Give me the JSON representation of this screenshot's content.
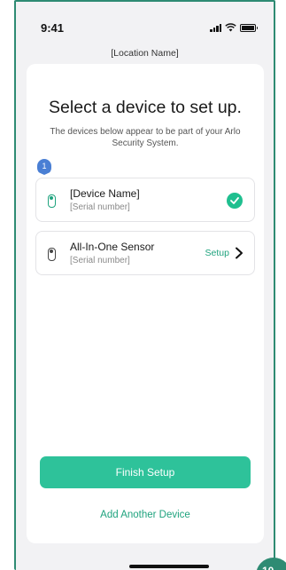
{
  "status_bar": {
    "time": "9:41"
  },
  "header": {
    "location_name": "[Location Name]"
  },
  "main": {
    "title": "Select a device to set up.",
    "subtitle": "The devices below appear to be part of your Arlo Security System.",
    "devices": [
      {
        "name": "[Device Name]",
        "serial": "[Serial number]",
        "state": "complete",
        "icon": "camera-icon"
      },
      {
        "name": "All-In-One Sensor",
        "serial": "[Serial number]",
        "action": "Setup",
        "icon": "sensor-icon"
      }
    ],
    "step_badge": "1"
  },
  "footer": {
    "finish_label": "Finish Setup",
    "add_device_label": "Add Another Device"
  },
  "page_number": "10",
  "colors": {
    "accent": "#2ec29a",
    "link": "#1fa37e",
    "frame": "#2e8b73",
    "badge": "#4a7fd4"
  }
}
